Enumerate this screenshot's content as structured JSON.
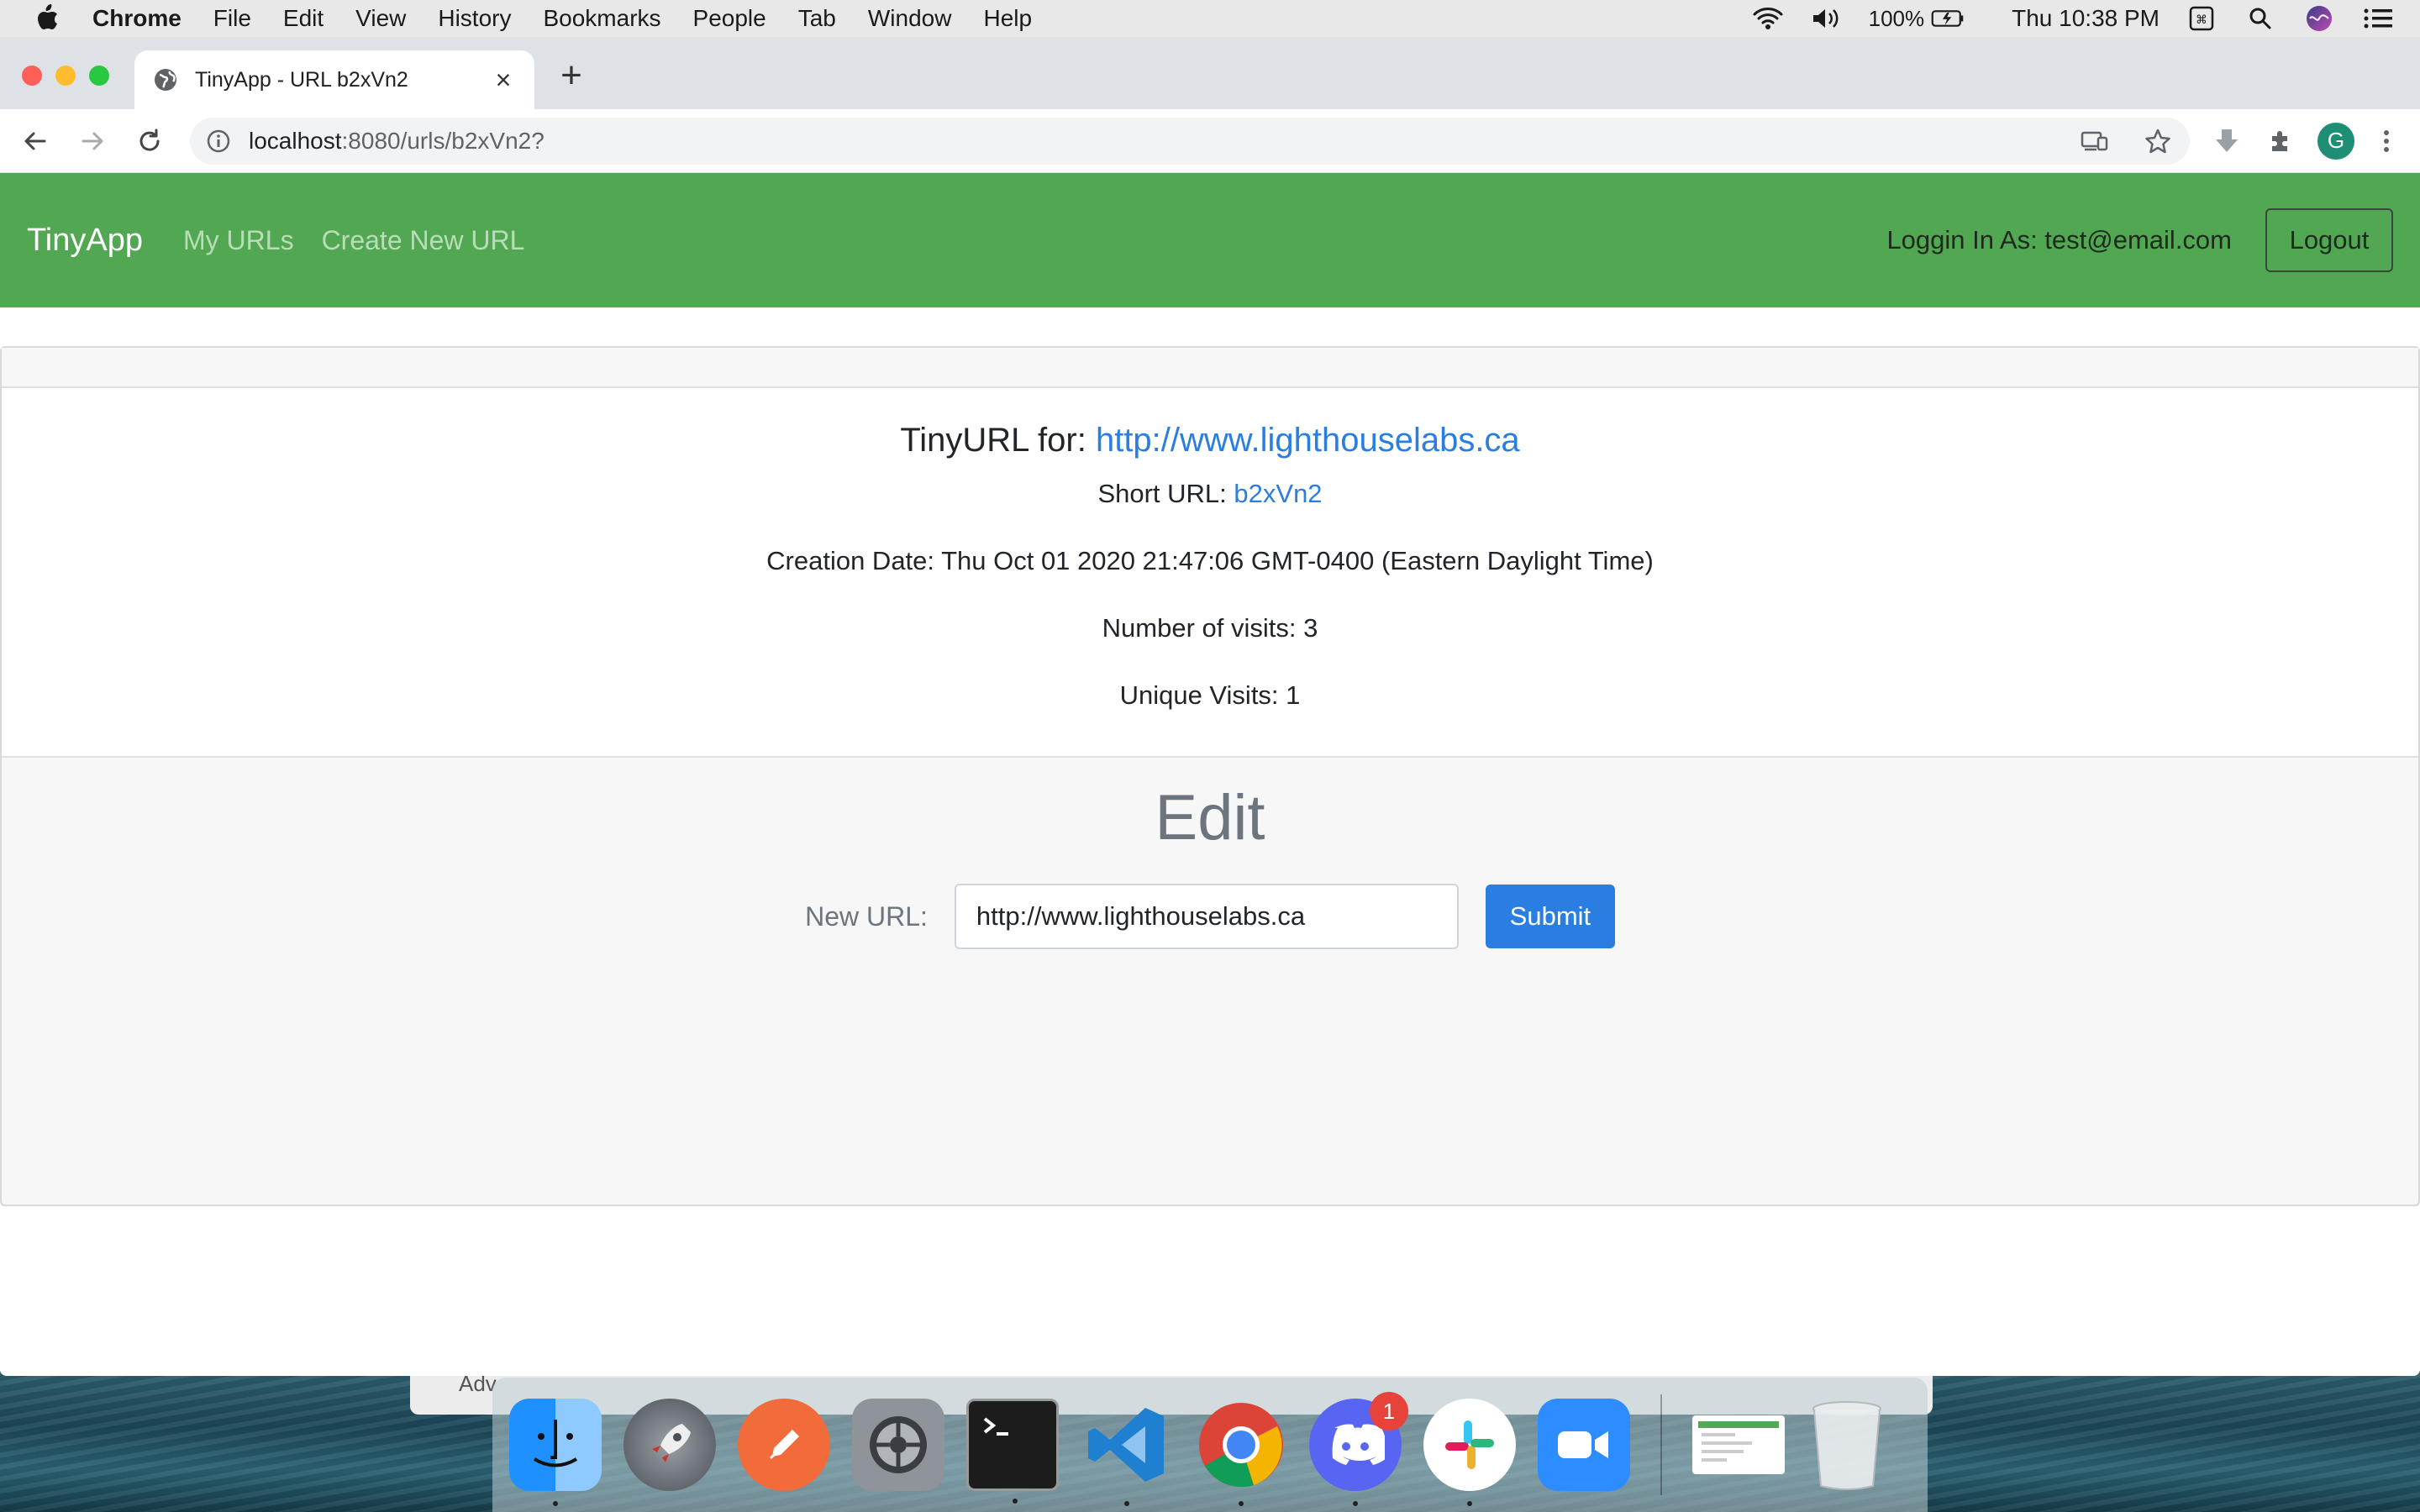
{
  "menubar": {
    "app": "Chrome",
    "items": [
      "File",
      "Edit",
      "View",
      "History",
      "Bookmarks",
      "People",
      "Tab",
      "Window",
      "Help"
    ],
    "battery": "100%",
    "clock": "Thu 10:38 PM"
  },
  "browser": {
    "tab_title": "TinyApp - URL b2xVn2",
    "url_host": "localhost",
    "url_path": ":8080/urls/b2xVn2?",
    "profile_initial": "G"
  },
  "navbar": {
    "brand": "TinyApp",
    "links": [
      "My URLs",
      "Create New URL"
    ],
    "login_text": "Loggin In As: test@email.com",
    "logout_label": "Logout"
  },
  "url_card": {
    "title_prefix": "TinyURL for: ",
    "long_url": "http://www.lighthouselabs.ca",
    "short_url_label": "Short URL: ",
    "short_url": "b2xVn2",
    "creation_date": "Creation Date: Thu Oct 01 2020 21:47:06 GMT-0400 (Eastern Daylight Time)",
    "visits": "Number of visits: 3",
    "unique_visits": "Unique Visits: 1"
  },
  "edit": {
    "title": "Edit",
    "label": "New URL:",
    "input_value": "http://www.lighthouselabs.ca",
    "submit_label": "Submit"
  },
  "background_window": {
    "partial_text": "Adv"
  },
  "dock": {
    "apps": [
      "finder",
      "launchpad",
      "postman",
      "system-preferences",
      "terminal",
      "vscode",
      "chrome",
      "discord",
      "slack",
      "zoom"
    ],
    "discord_badge": "1"
  },
  "colors": {
    "navbar": "#52a752",
    "link": "#2a7de1",
    "submit": "#2a7de1"
  }
}
